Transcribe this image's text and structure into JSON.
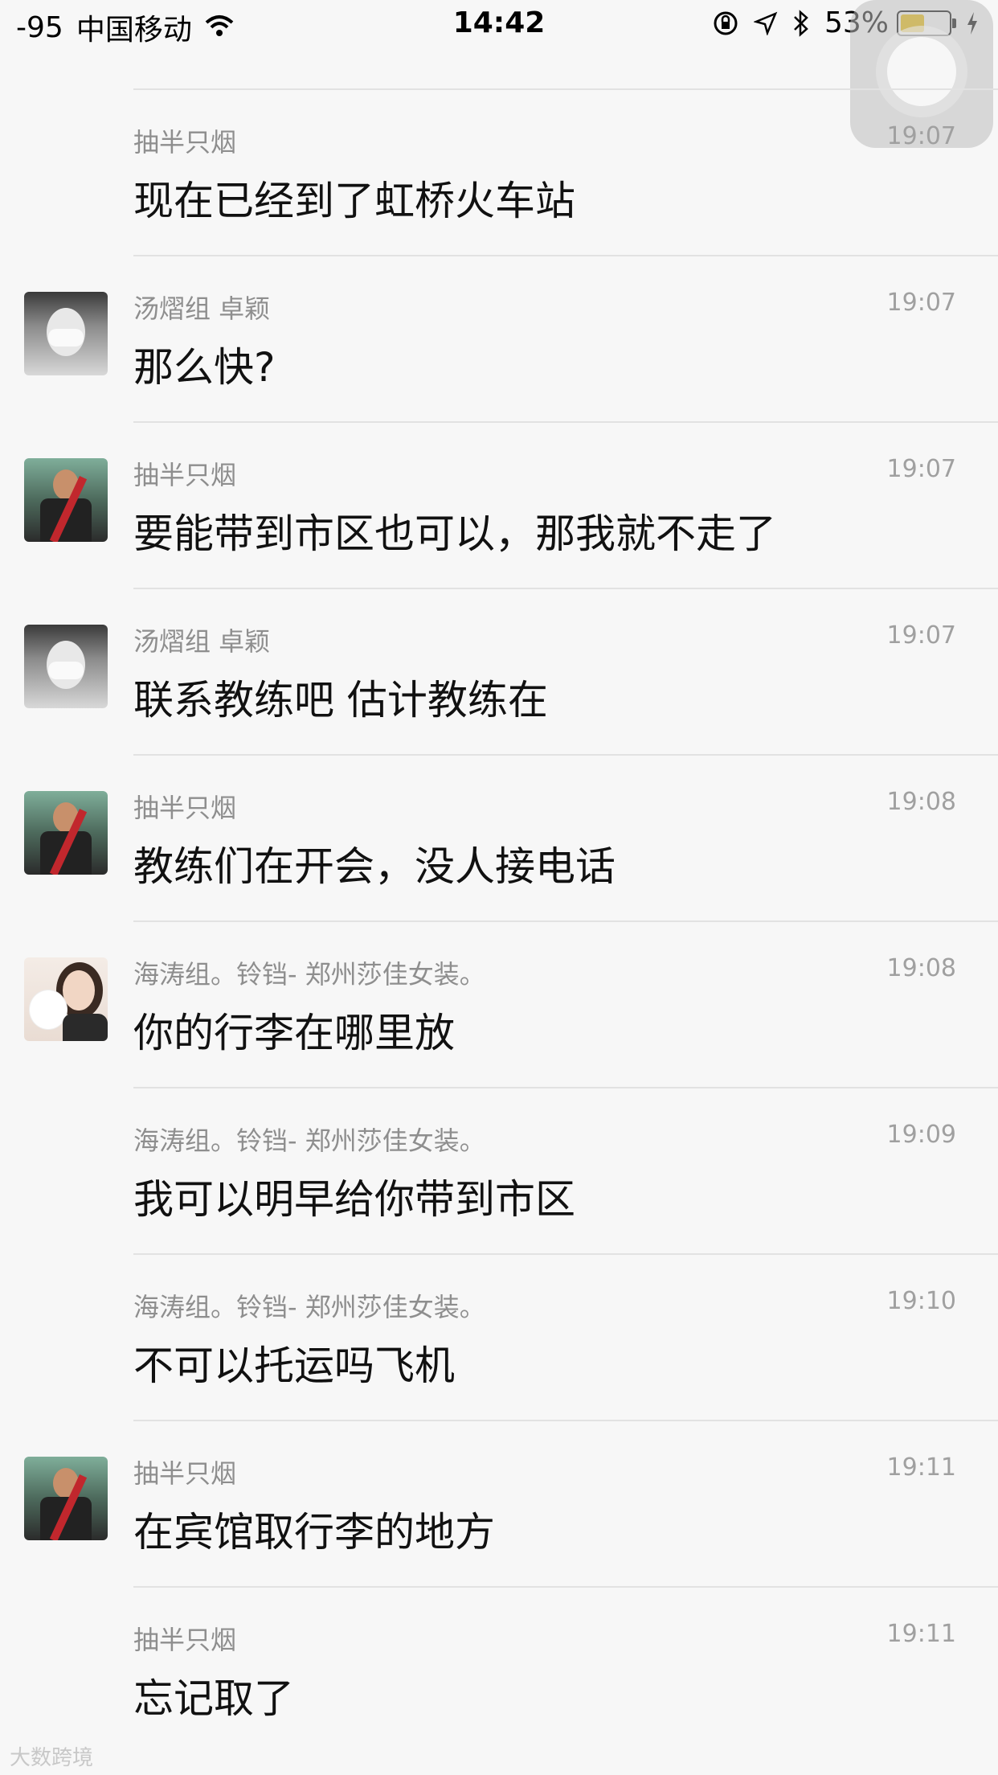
{
  "status_bar": {
    "signal": "-95",
    "carrier": "中国移动",
    "time": "14:42",
    "battery": "53%",
    "battery_level": 0.53,
    "icons": [
      "wifi-icon",
      "orientation-lock-icon",
      "location-icon",
      "bluetooth-icon",
      "battery-icon",
      "charging-icon"
    ]
  },
  "messages": [
    {
      "sender": "抽半只烟",
      "time": "19:07",
      "text": "现在已经到了虹桥火车站",
      "avatar": "none"
    },
    {
      "sender": "汤熠组 卓颖",
      "time": "19:07",
      "text": "那么快?",
      "avatar": "mask"
    },
    {
      "sender": "抽半只烟",
      "time": "19:07",
      "text": "要能带到市区也可以，那我就不走了",
      "avatar": "guy"
    },
    {
      "sender": "汤熠组 卓颖",
      "time": "19:07",
      "text": "联系教练吧 估计教练在",
      "avatar": "mask"
    },
    {
      "sender": "抽半只烟",
      "time": "19:08",
      "text": "教练们在开会，没人接电话",
      "avatar": "guy"
    },
    {
      "sender": "海涛组。铃铛- 郑州莎佳女装。",
      "time": "19:08",
      "text": "你的行李在哪里放",
      "avatar": "girl"
    },
    {
      "sender": "海涛组。铃铛- 郑州莎佳女装。",
      "time": "19:09",
      "text": "我可以明早给你带到市区",
      "avatar": "none"
    },
    {
      "sender": "海涛组。铃铛- 郑州莎佳女装。",
      "time": "19:10",
      "text": "不可以托运吗飞机",
      "avatar": "none"
    },
    {
      "sender": "抽半只烟",
      "time": "19:11",
      "text": "在宾馆取行李的地方",
      "avatar": "guy"
    },
    {
      "sender": "抽半只烟",
      "time": "19:11",
      "text": "忘记取了",
      "avatar": "none"
    }
  ],
  "watermark": "大数跨境"
}
